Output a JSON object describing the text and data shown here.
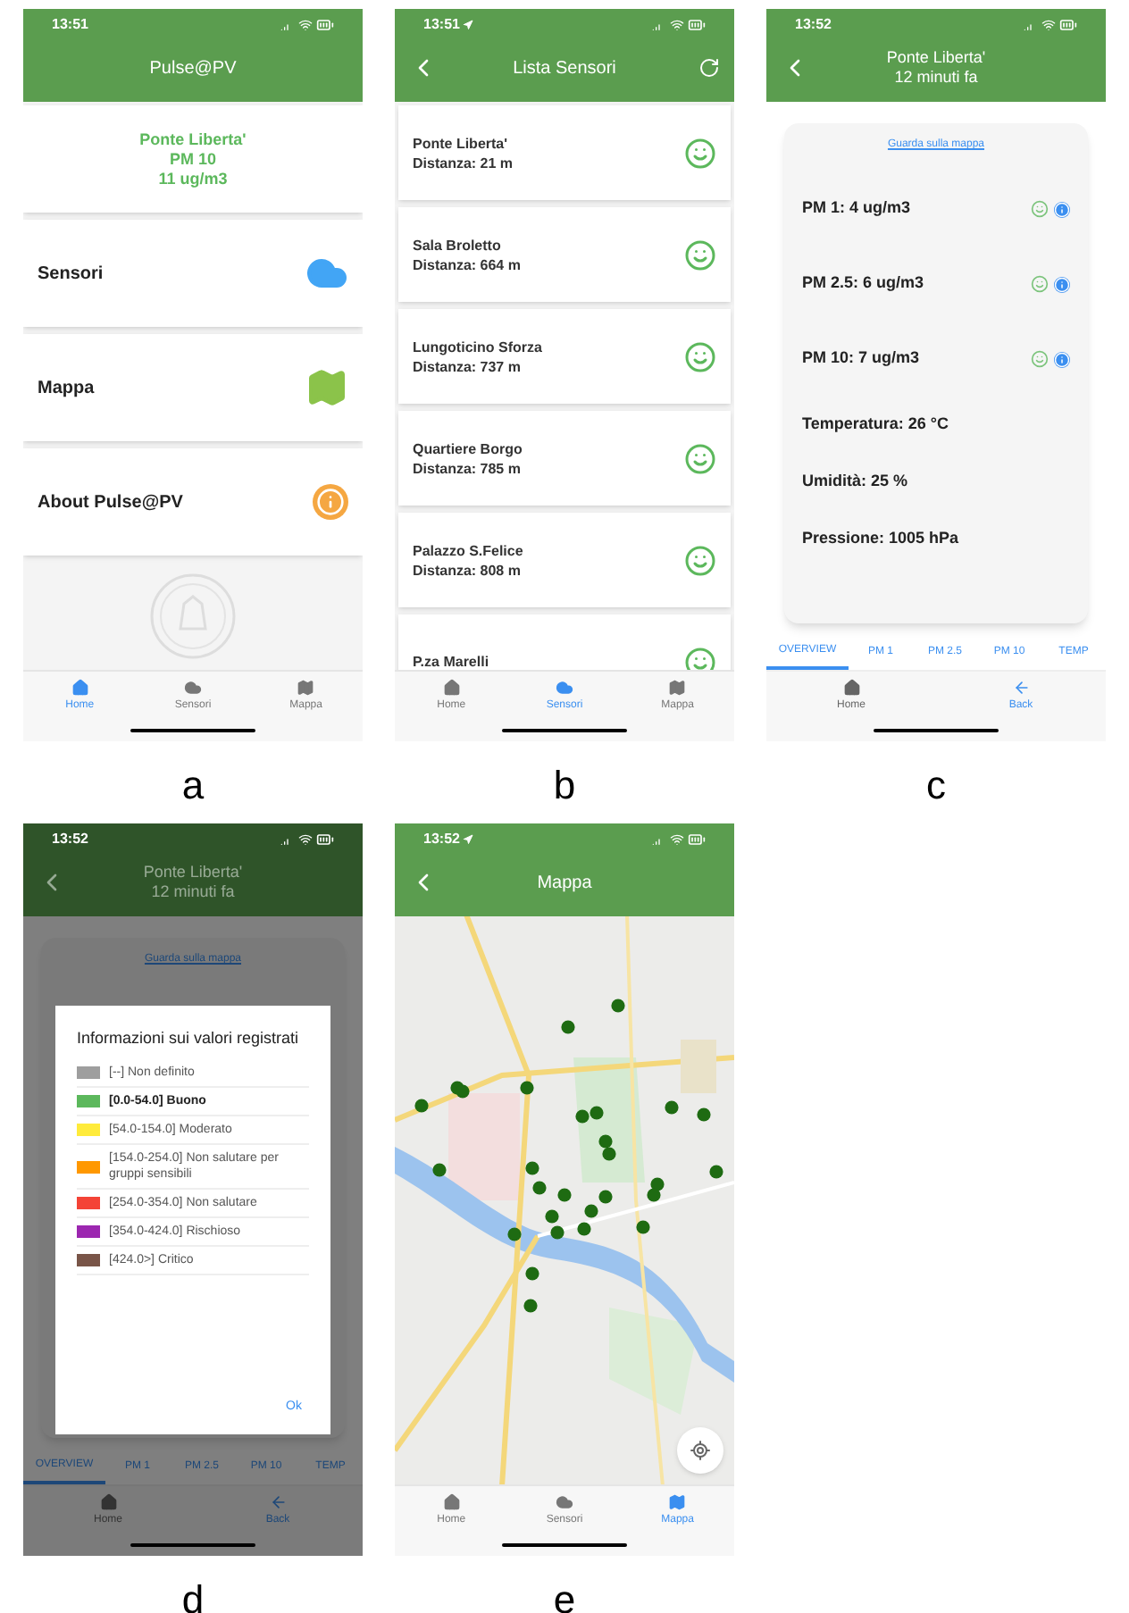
{
  "screens": [
    {
      "kind": "home",
      "label": "a",
      "status_time": "13:51",
      "location": false,
      "title": "Pulse@PV",
      "highlight": [
        "Ponte Liberta'",
        "PM 10",
        "11 ug/m3"
      ],
      "menu": [
        {
          "label": "Sensori"
        },
        {
          "label": "Mappa"
        },
        {
          "label": "About Pulse@PV"
        }
      ],
      "tabbar": [
        {
          "label": "Home",
          "selected": true
        },
        {
          "label": "Sensori",
          "selected": false
        },
        {
          "label": "Mappa",
          "selected": false
        }
      ]
    },
    {
      "kind": "list",
      "label": "b",
      "status_time": "13:51",
      "location": true,
      "title": "Lista Sensori",
      "sensors": [
        {
          "name": "Ponte Liberta'",
          "distance": "Distanza: 21 m"
        },
        {
          "name": "Sala Broletto",
          "distance": "Distanza: 664 m"
        },
        {
          "name": "Lungoticino Sforza",
          "distance": "Distanza: 737 m"
        },
        {
          "name": "Quartiere Borgo",
          "distance": "Distanza: 785 m"
        },
        {
          "name": "Palazzo S.Felice",
          "distance": "Distanza: 808 m"
        },
        {
          "name": "P.za Marelli"
        }
      ],
      "tabbar": [
        {
          "label": "Home",
          "selected": false
        },
        {
          "label": "Sensori",
          "selected": true
        },
        {
          "label": "Mappa",
          "selected": false
        }
      ]
    },
    {
      "kind": "detail",
      "label": "c",
      "status_time": "13:52",
      "location": false,
      "title": "Ponte Liberta'",
      "subtitle": "12 minuti fa",
      "map_link": "Guarda sulla mappa",
      "readings": [
        {
          "kind": "pm",
          "text": "PM 1: 4 ug/m3"
        },
        {
          "kind": "pm",
          "text": "PM 2.5: 6 ug/m3"
        },
        {
          "kind": "pm",
          "text": "PM 10: 7 ug/m3"
        },
        {
          "kind": "plain",
          "text": "Temperatura: 26 °C"
        },
        {
          "kind": "plain",
          "text": "Umidità: 25 %"
        },
        {
          "kind": "plain",
          "text": "Pressione: 1005 hPa"
        }
      ],
      "tabs": [
        {
          "label": "OVERVIEW",
          "selected": true
        },
        {
          "label": "PM 1",
          "selected": false
        },
        {
          "label": "PM 2.5",
          "selected": false
        },
        {
          "label": "PM 10",
          "selected": false
        },
        {
          "label": "TEMP",
          "selected": false
        }
      ],
      "bottom": [
        {
          "kind": "home",
          "label": "Home"
        },
        {
          "kind": "back",
          "label": "Back"
        }
      ]
    },
    {
      "kind": "detail",
      "label": "d",
      "status_time": "13:52",
      "location": false,
      "title": "Ponte Liberta'",
      "subtitle": "12 minuti fa",
      "map_link": "Guarda sulla mappa",
      "tabs": [
        {
          "label": "OVERVIEW",
          "selected": true
        },
        {
          "label": "PM 1",
          "selected": false
        },
        {
          "label": "PM 2.5",
          "selected": false
        },
        {
          "label": "PM 10",
          "selected": false
        },
        {
          "label": "TEMP",
          "selected": false
        }
      ],
      "bottom": [
        {
          "kind": "home",
          "label": "Home"
        },
        {
          "kind": "back",
          "label": "Back"
        }
      ],
      "dialog": {
        "title": "Informazioni sui valori registrati",
        "ok": "Ok",
        "items": [
          {
            "color": "#9e9e9e",
            "text": "[--] Non definito",
            "selected": false
          },
          {
            "color": "#5cb85c",
            "text": "[0.0-54.0] Buono",
            "selected": true
          },
          {
            "color": "#ffeb3b",
            "text": "[54.0-154.0] Moderato",
            "selected": false
          },
          {
            "color": "#ff9800",
            "text": "[154.0-254.0] Non salutare per gruppi sensibili",
            "selected": false
          },
          {
            "color": "#f44336",
            "text": "[254.0-354.0] Non salutare",
            "selected": false
          },
          {
            "color": "#9c27b0",
            "text": "[354.0-424.0] Rischioso",
            "selected": false
          },
          {
            "color": "#795548",
            "text": "[424.0>] Critico",
            "selected": false
          }
        ]
      }
    },
    {
      "kind": "map",
      "label": "e",
      "status_time": "13:52",
      "location": true,
      "title": "Mappa",
      "tabbar": [
        {
          "label": "Home",
          "selected": false
        },
        {
          "label": "Sensori",
          "selected": false
        },
        {
          "label": "Mappa",
          "selected": true
        }
      ]
    }
  ]
}
